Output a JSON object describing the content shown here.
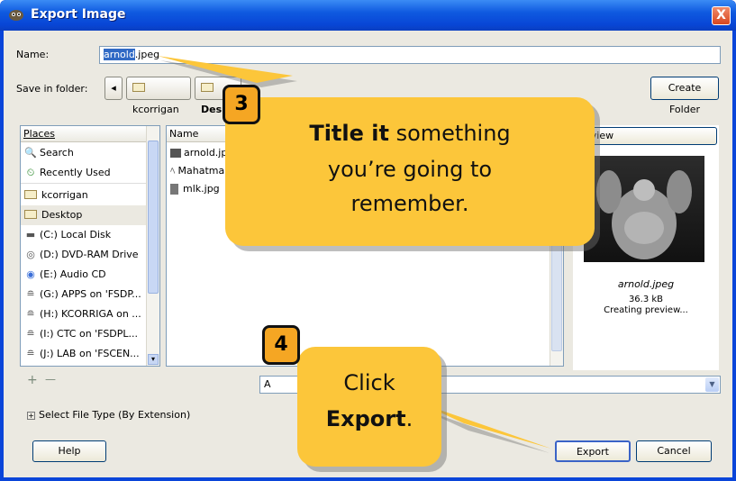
{
  "window": {
    "title": "Export Image",
    "close_label": "X"
  },
  "name_row": {
    "label": "Name:",
    "value_selected": "arnold",
    "value_rest": ".jpeg"
  },
  "save_row": {
    "label": "Save in folder:",
    "back_arrow": "◂",
    "crumbs": [
      "kcorrigan",
      "Desk"
    ],
    "create_folder": "Create Folder"
  },
  "places": {
    "header": "Places",
    "items": [
      {
        "label": "Search",
        "icon": "🔍"
      },
      {
        "label": "Recently Used",
        "icon": "⏲"
      },
      {
        "label": "kcorrigan",
        "icon": "folder"
      },
      {
        "label": "Desktop",
        "icon": "folder"
      },
      {
        "label": "(C:) Local Disk",
        "icon": "disk"
      },
      {
        "label": "(D:) DVD-RAM Drive",
        "icon": "cd"
      },
      {
        "label": "(E:) Audio CD",
        "icon": "cd"
      },
      {
        "label": "(G:) APPS on 'FSDP...",
        "icon": "net"
      },
      {
        "label": "(H:) KCORRIGA on ...",
        "icon": "net"
      },
      {
        "label": "(I:) CTC on 'FSDPL...",
        "icon": "net"
      },
      {
        "label": "(J:) LAB on 'FSCEN...",
        "icon": "net"
      }
    ],
    "add_icon": "+",
    "remove_icon": "—"
  },
  "files": {
    "header": "Name",
    "items": [
      {
        "label": "arnold.jp"
      },
      {
        "label": "Mahatma"
      },
      {
        "label": "mlk.jpg"
      }
    ],
    "filter_prefix": "A"
  },
  "preview": {
    "header": "eview",
    "filename": "arnold.jpeg",
    "size": "36.3 kB",
    "status": "Creating preview..."
  },
  "file_type_toggle": "Select File Type (By Extension)",
  "buttons": {
    "help": "Help",
    "export": "Export",
    "cancel": "Cancel"
  },
  "callout_3": {
    "number": "3",
    "bold": "Title it",
    "line1_rest": " something",
    "line2": "you’re going to",
    "line3": "remember."
  },
  "callout_4": {
    "number": "4",
    "line1": "Click",
    "bold": "Export",
    "punct": "."
  },
  "colors": {
    "callout": "#fcc63a",
    "badge": "#f5a623",
    "titlebar": "#0a45d9"
  }
}
